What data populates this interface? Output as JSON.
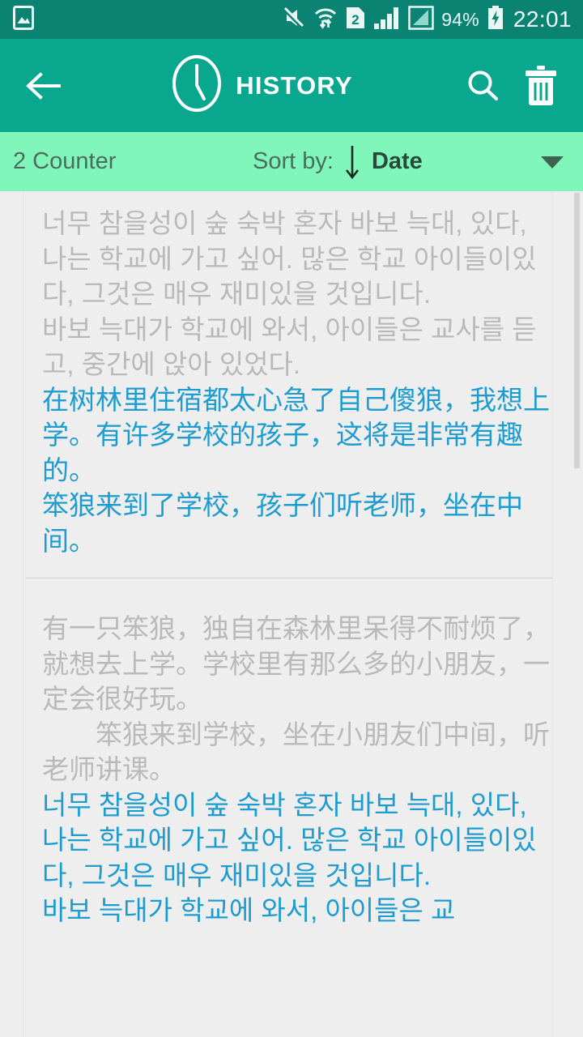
{
  "status_bar": {
    "background_color": "#0b8372",
    "left_icons": [
      {
        "name": "image-indicator-icon",
        "glyph": "picture"
      }
    ],
    "right_icons": [
      {
        "name": "mute-icon",
        "glyph": "bell-muted"
      },
      {
        "name": "wifi-transfer-icon",
        "glyph": "wifi-updown"
      },
      {
        "name": "dual-sim-icon",
        "glyph": "sim-2",
        "label": "2"
      },
      {
        "name": "signal-sim1-icon",
        "glyph": "bars"
      },
      {
        "name": "signal-sim2-icon",
        "glyph": "bars-boxed"
      }
    ],
    "battery_percent": "94%",
    "battery_icon": "battery-charging-icon",
    "clock": "22:01"
  },
  "app_bar": {
    "background_color": "#0aa78f",
    "back_label": "Back",
    "clock_icon": "clock-icon",
    "title": "HISTORY",
    "search_label": "Search",
    "delete_label": "Delete all"
  },
  "sort_bar": {
    "background_color": "#80f6ba",
    "counter": "2 Counter",
    "sort_by_label": "Sort by:",
    "sort_direction_icon": "arrow-down-icon",
    "sort_value": "Date",
    "dropdown_icon": "caret-down-icon"
  },
  "history": {
    "items": [
      {
        "source_color": "#b9b9b9",
        "target_color": "#1e9cd0",
        "source_paragraphs": [
          "너무 참을성이 숲 숙박 혼자 바보 늑대, 있다, 나는 학교에 가고 싶어. 많은 학교 아이들이있다, 그것은 매우 재미있을 것입니다.",
          "바보 늑대가 학교에 와서, 아이들은 교사를 듣고, 중간에 앉아 있었다."
        ],
        "target_paragraphs": [
          "在树林里住宿都太心急了自己傻狼，我想上学。有许多学校的孩子，这将是非常有趣的。",
          "笨狼来到了学校，孩子们听老师，坐在中间。"
        ]
      },
      {
        "source_color": "#b9b9b9",
        "target_color": "#1e9cd0",
        "source_paragraphs": [
          "有一只笨狼，独自在森林里呆得不耐烦了，就想去上学。学校里有那么多的小朋友，一定会很好玩。",
          "　　笨狼来到学校，坐在小朋友们中间，听老师讲课。"
        ],
        "target_paragraphs": [
          "너무 참을성이 숲 숙박 혼자 바보 늑대, 있다, 나는 학교에 가고 싶어. 많은 학교 아이들이있다, 그것은 매우 재미있을 것입니다.",
          "바보 늑대가 학교에 와서, 아이들은 교"
        ]
      }
    ]
  }
}
